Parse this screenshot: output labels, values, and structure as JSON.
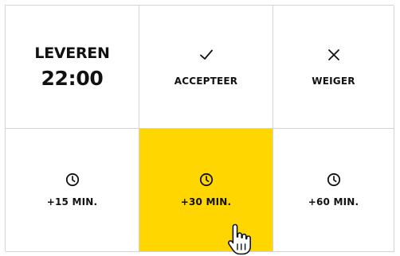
{
  "deliver": {
    "label": "LEVEREN",
    "time": "22:00"
  },
  "actions": {
    "accept_label": "ACCEPTEER",
    "reject_label": "WEIGER"
  },
  "delays": [
    {
      "label": "+15 MIN."
    },
    {
      "label": "+30 MIN."
    },
    {
      "label": "+60 MIN."
    }
  ],
  "colors": {
    "highlight": "#ffd600",
    "border": "#d3d3d3",
    "text": "#111111"
  },
  "icons": {
    "accept": "check-icon",
    "reject": "close-icon",
    "delay": "clock-icon",
    "cursor": "hand-pointer-cursor"
  }
}
